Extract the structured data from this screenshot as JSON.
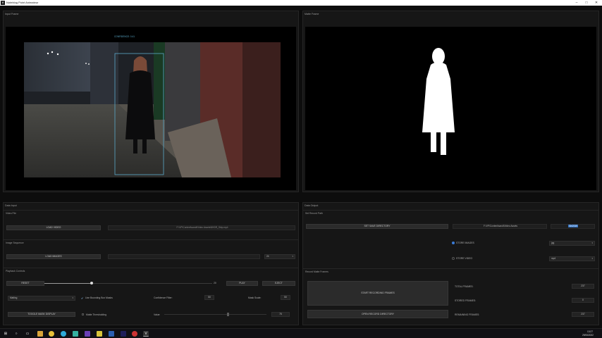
{
  "window": {
    "title": "Noteblog Point Animateur",
    "app_icon": "V",
    "minimize_glyph": "–",
    "maximize_glyph": "□",
    "close_glyph": "✕"
  },
  "input_frame": {
    "label": "Input Frame",
    "detection_label": "CONFIDENCE: 0.41"
  },
  "matte_frame": {
    "label": "Matte Frame"
  },
  "data_input": {
    "label": "Data Input",
    "video_file": {
      "label": "Video File",
      "load_button": "LOAD VIDEO",
      "path": "F:\\VP\\Content\\sandt\\Video Assets\\5HDR_Strip.mp4"
    },
    "image_sequence": {
      "label": "Image Sequence",
      "load_button": "LOAD IMAGES",
      "fps_value": "24"
    },
    "playback": {
      "label": "Playback Controls",
      "reset_button": "RESET",
      "frame_value": "20",
      "slider_fraction": 0.28,
      "play_button": "PLAY",
      "eject_button": "EJECT",
      "mode_value": "Matting",
      "use_bbox_label": "Use Bounding Box Masks",
      "confidence_label": "Confidence Filter:",
      "confidence_value": "50",
      "mask_scale_label": "Mask Scale:",
      "mask_scale_value": "50",
      "toggle_mask_button": "TOGGLE MASK DISPLAY",
      "matte_threshold_label": "Matte Thresholding",
      "value_label": "Value:",
      "threshold_value": "75",
      "threshold_fraction": 0.62
    }
  },
  "data_output": {
    "label": "Data Output",
    "record_path": {
      "label": "Set Record Path",
      "set_dir_button": "SET SAVE DIRECTORY",
      "path": "F:\\VP\\Content\\sandt\\Video Assets",
      "folder_name": "Girl2019",
      "store_images_label": "STORE IMAGES",
      "image_format": "jpg",
      "store_video_label": "STORE VIDEO",
      "video_format": "mp4"
    },
    "record": {
      "label": "Record Matte Frames",
      "start_button": "START RECORDING FRAMES",
      "open_dir_button": "OPEN RECORD DIRECTORY",
      "total_label": "TOTAL FRAMES:",
      "total_value": "237",
      "stored_label": "STORED FRAMES:",
      "stored_value": "0",
      "remaining_label": "REMAINING FRAMES:",
      "remaining_value": "237"
    }
  },
  "taskbar": {
    "clock_time": "13:27",
    "clock_date": "29/06/2022",
    "start_icon": "windows-icon",
    "colors": {
      "accent": "#3a7bd5",
      "bbox": "#5aa9c9",
      "selection": "#2f6fbf"
    }
  }
}
